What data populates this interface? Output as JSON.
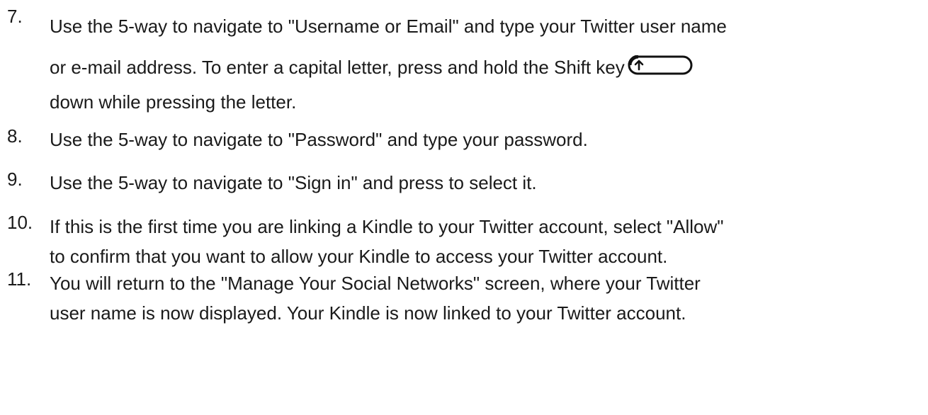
{
  "steps": [
    {
      "number": "7.",
      "lines": [
        "Use the 5-way to navigate to \"Username or Email\" and type your Twitter user name",
        "or e-mail address. To enter a capital letter, press and hold the Shift key",
        "down while pressing the letter."
      ],
      "inline_icon": "shift-key-icon"
    },
    {
      "number": "8.",
      "lines": [
        "Use the 5-way to navigate to \"Password\" and type your password."
      ]
    },
    {
      "number": "9.",
      "lines": [
        "Use the 5-way to navigate to \"Sign in\" and press to select it."
      ]
    },
    {
      "number": "10.",
      "lines": [
        "If this is the first time you are linking a Kindle to your Twitter account, select \"Allow\"",
        "to confirm that you want to allow your Kindle to access your Twitter account."
      ]
    },
    {
      "number": "11.",
      "lines": [
        "You will return to the \"Manage Your Social Networks\" screen, where your Twitter",
        "user name is now displayed. Your Kindle is now linked to your Twitter account."
      ]
    }
  ],
  "colors": {
    "text": "#1a1a1a",
    "background": "#ffffff"
  }
}
